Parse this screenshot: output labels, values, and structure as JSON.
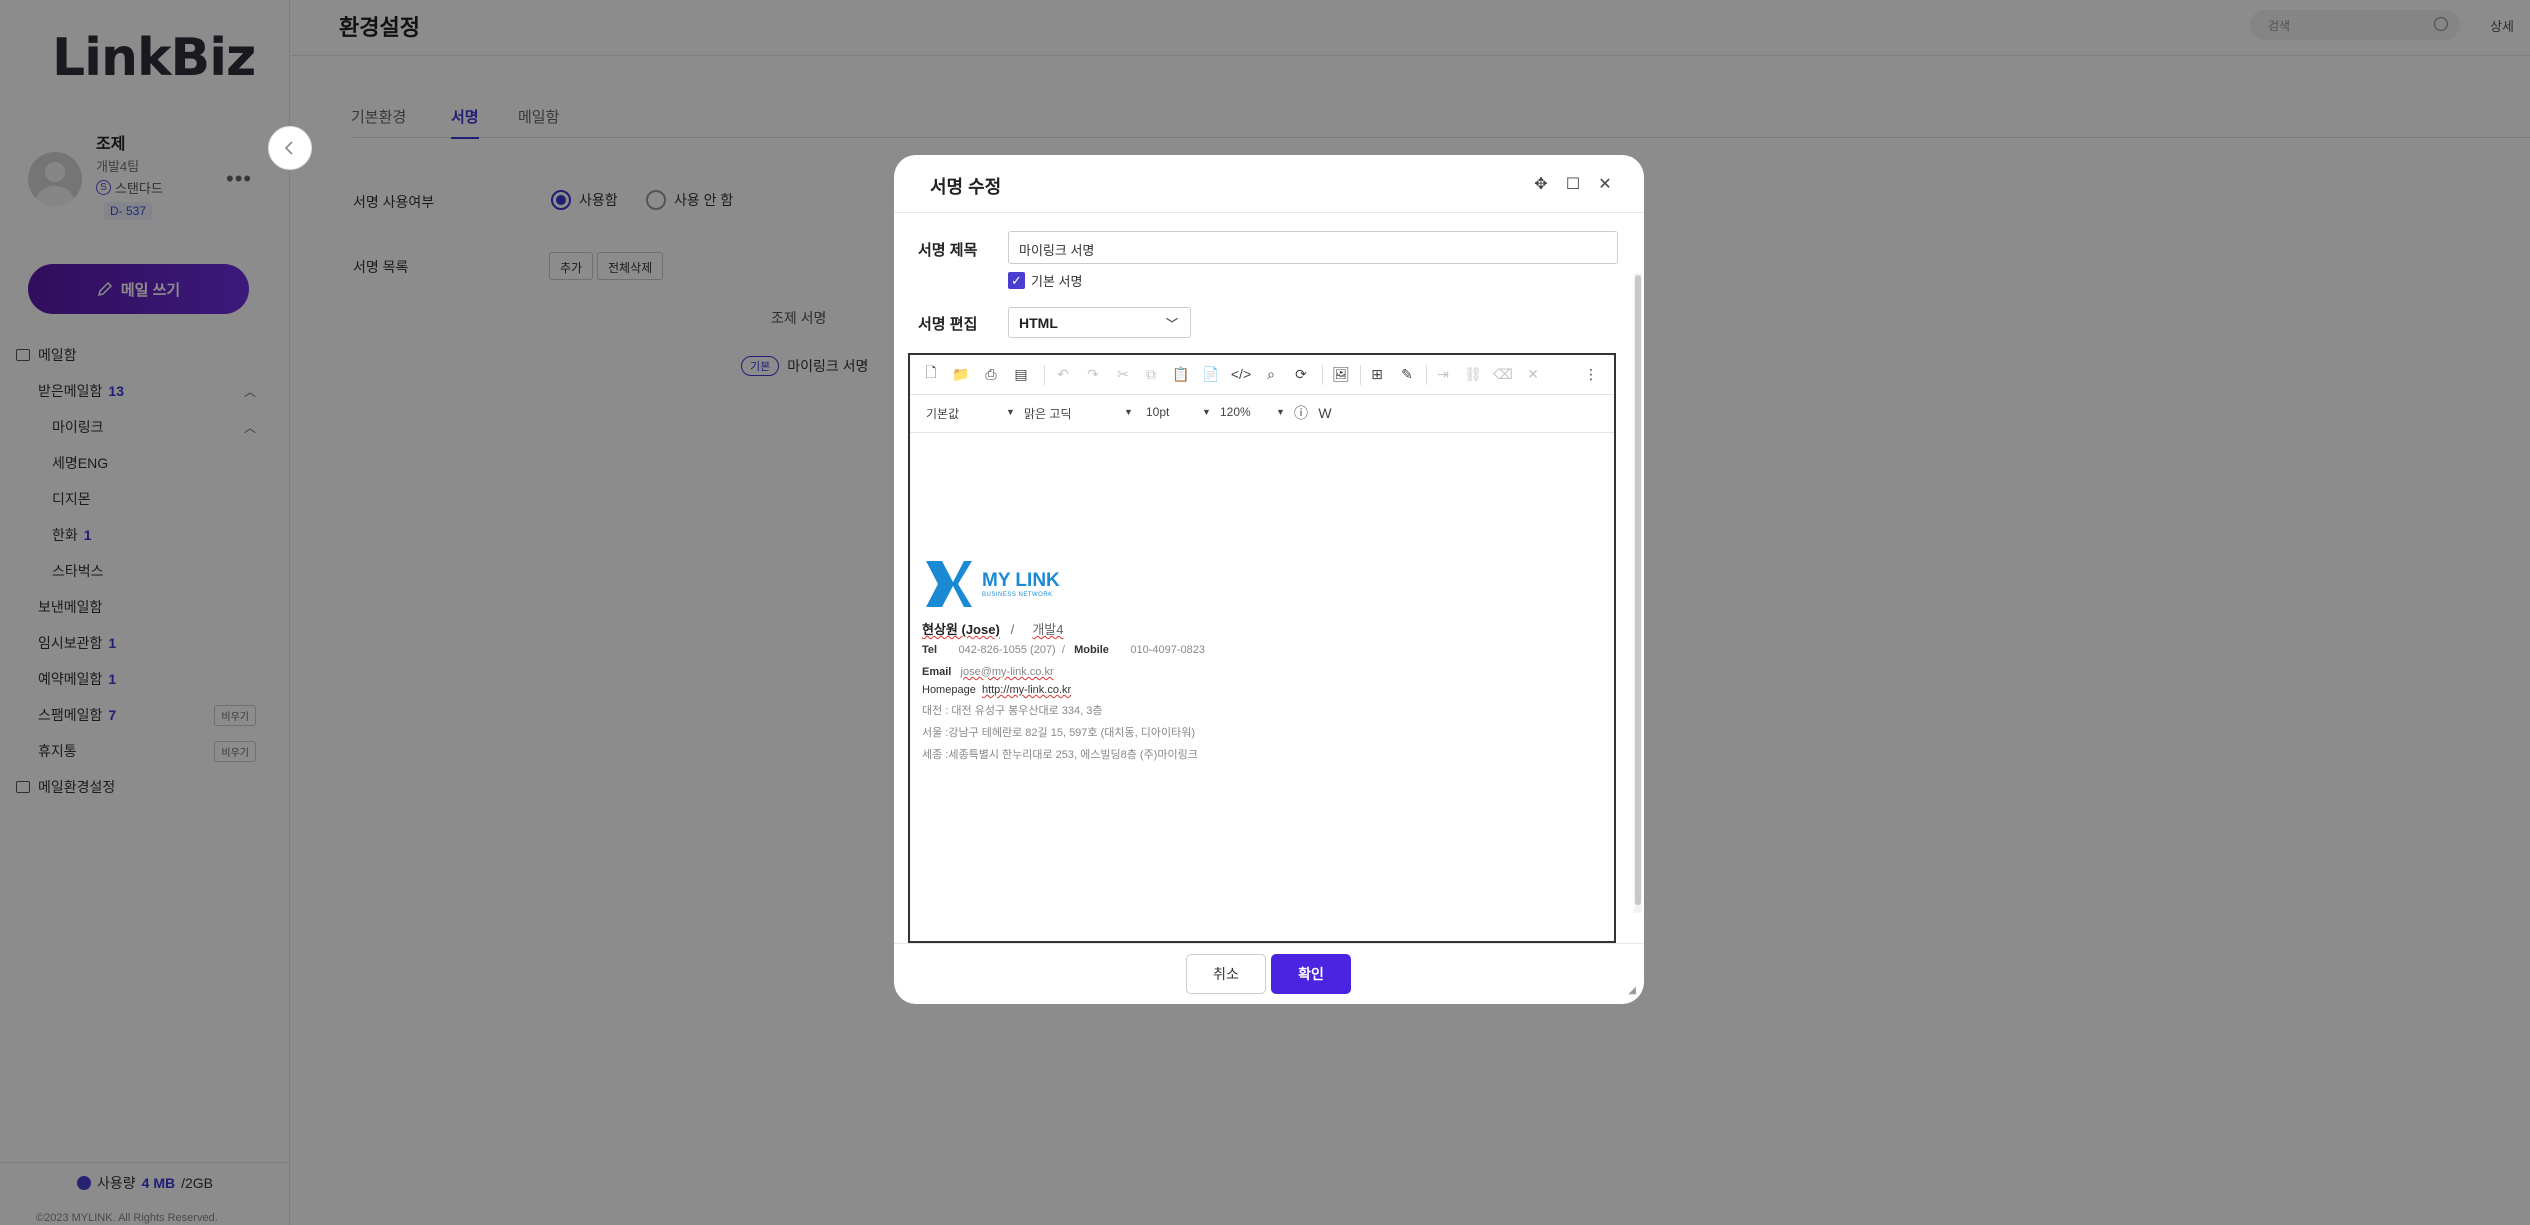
{
  "sidebar": {
    "logo": "LinkBiz",
    "user": {
      "name": "조제",
      "team": "개발4팀",
      "plan": "스탠다드",
      "dday": "D- 537"
    },
    "write_button": "메일 쓰기",
    "nav": [
      {
        "label": "메일함",
        "count": "",
        "indent": 0,
        "icon": "mail-icon"
      },
      {
        "label": "받은메일함",
        "count": "13",
        "indent": 1,
        "chevron": "up"
      },
      {
        "label": "마이링크",
        "count": "",
        "indent": 2,
        "chevron": "up"
      },
      {
        "label": "세명ENG",
        "count": "",
        "indent": 2
      },
      {
        "label": "디지몬",
        "count": "",
        "indent": 2
      },
      {
        "label": "한화",
        "count": "1",
        "indent": 2
      },
      {
        "label": "스타벅스",
        "count": "",
        "indent": 2
      },
      {
        "label": "보낸메일함",
        "count": "",
        "indent": 1
      },
      {
        "label": "임시보관함",
        "count": "1",
        "indent": 1
      },
      {
        "label": "예약메일함",
        "count": "1",
        "indent": 1
      },
      {
        "label": "스팸메일함",
        "count": "7",
        "indent": 1,
        "empty": "비우기"
      },
      {
        "label": "휴지통",
        "count": "",
        "indent": 1,
        "empty": "비우기"
      },
      {
        "label": "메일환경설정",
        "count": "",
        "indent": 0,
        "icon": "mail-icon"
      }
    ],
    "usage": {
      "label": "사용량",
      "used": "4 MB",
      "total": "/2GB"
    },
    "copyright": "©2023 MYLINK. All Rights Reserved."
  },
  "header": {
    "title": "환경설정",
    "search_placeholder": "검색",
    "detail": "상세"
  },
  "tabs": [
    "기본환경",
    "서명",
    "메일함"
  ],
  "settings": {
    "use_label": "서명 사용여부",
    "use_on": "사용함",
    "use_off": "사용 안 함",
    "list_label": "서명 목록",
    "add_btn": "추가",
    "delete_all_btn": "전체삭제",
    "list_items": [
      {
        "name": "조제 서명",
        "basic": ""
      },
      {
        "name": "마이링크 서명",
        "basic": "기본"
      }
    ]
  },
  "modal": {
    "title": "서명 수정",
    "title_label": "서명 제목",
    "title_value": "마이링크 서명",
    "default_check": "기본 서명",
    "edit_label": "서명 편집",
    "edit_mode": "HTML",
    "toolbar2": {
      "style": "기본값",
      "font": "맑은 고딕",
      "size": "10pt",
      "line": "120%"
    },
    "signature": {
      "brand": "MY LINK",
      "brand_sub": "BUSINESS NETWORK",
      "name": "현상원 (Jose)",
      "sep": "/",
      "dept": "개발4",
      "tel_label": "Tel",
      "tel": "042-826-1055 (207)",
      "mobile_label": "Mobile",
      "mobile": "010-4097-0823",
      "email_label": "Email",
      "email": "jose@my-link.co.kr",
      "home_label": "Homepage",
      "home": "http://my-link.co.kr",
      "addr1": "대전 : 대전 유성구 봉우산대로 334, 3층",
      "addr2": "서울 :강남구 테헤란로 82길 15, 597호 (대치동, 디아이타워)",
      "addr3": "세종 :세종특별시 한누리대로 253, 에스빌딩8층 (주)마이링크"
    },
    "cancel": "취소",
    "ok": "확인"
  },
  "colors": {
    "accent": "#4a24e0",
    "brand_blue": "#1a8ad6"
  }
}
